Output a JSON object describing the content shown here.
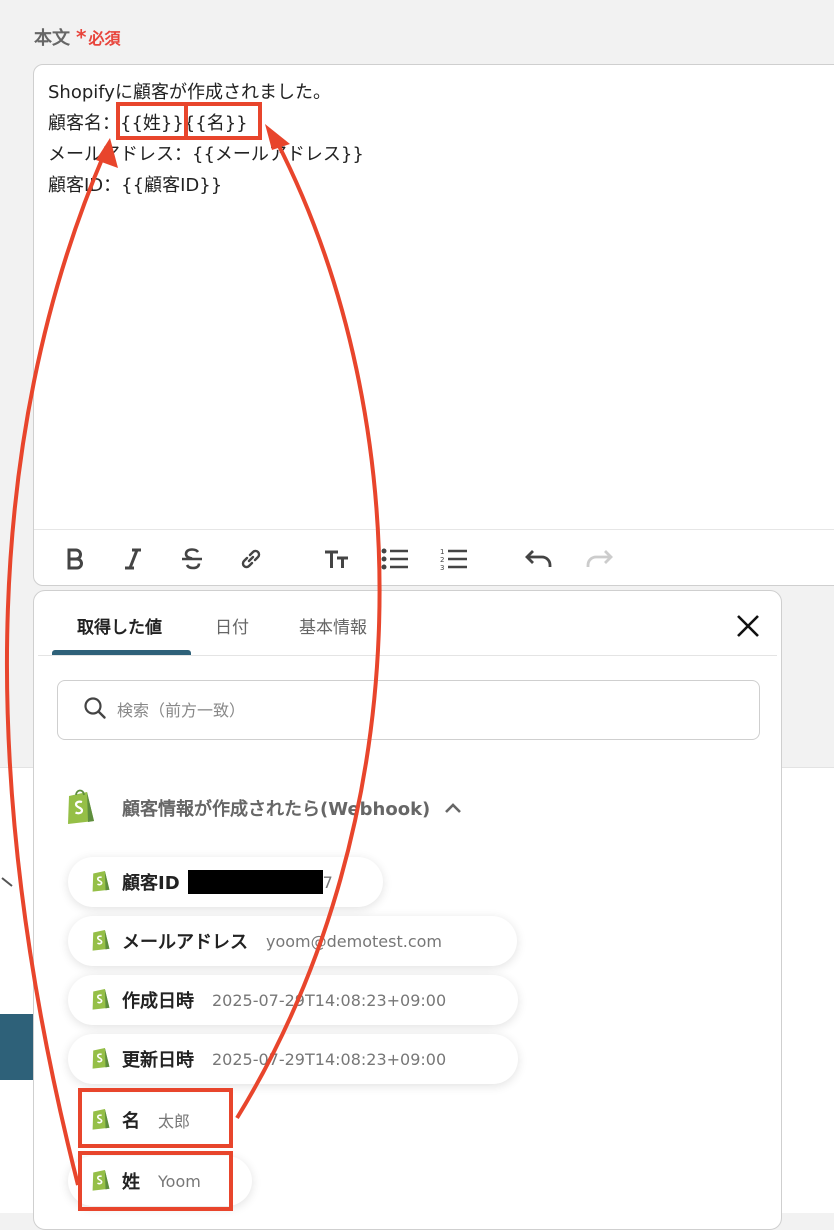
{
  "field": {
    "label": "本文",
    "required_star": "*",
    "required_text": "必須"
  },
  "editor": {
    "lines": [
      "Shopifyに顧客が作成されました。",
      "顧客名：{{姓}}{{名}}",
      "メールアドレス：{{メールアドレス}}",
      "顧客ID：{{顧客ID}}"
    ],
    "toolbar": [
      "bold-icon",
      "italic-icon",
      "strikethrough-icon",
      "link-icon",
      "font-size-icon",
      "bullet-list-icon",
      "numbered-list-icon",
      "undo-icon",
      "redo-icon"
    ]
  },
  "popup": {
    "tabs": [
      {
        "label": "取得した値"
      },
      {
        "label": "日付"
      },
      {
        "label": "基本情報"
      }
    ],
    "search_placeholder": "検索（前方一致）",
    "section_title": "顧客情報が作成されたら(Webhook)",
    "items": [
      {
        "label": "顧客ID",
        "value": "7"
      },
      {
        "label": "メールアドレス",
        "value": "yoom@demotest.com"
      },
      {
        "label": "作成日時",
        "value": "2025-07-29T14:08:23+09:00"
      },
      {
        "label": "更新日時",
        "value": "2025-07-29T14:08:23+09:00"
      },
      {
        "label": "名",
        "value": "太郎"
      },
      {
        "label": "姓",
        "value": "Yoom"
      }
    ]
  },
  "colors": {
    "accent": "#2e6179",
    "highlight": "#e8452c",
    "shopify_green": "#95bf47"
  }
}
